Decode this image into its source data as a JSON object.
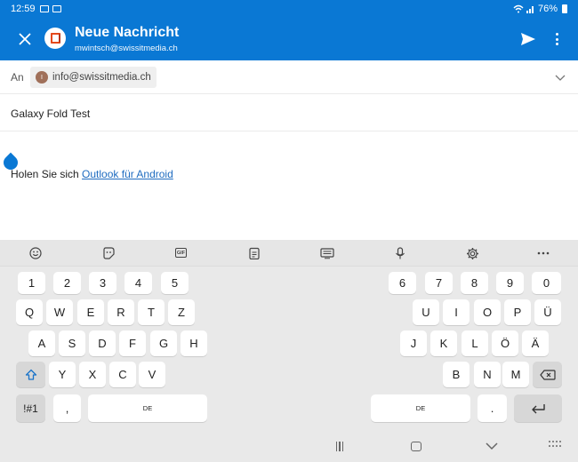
{
  "status_bar": {
    "time": "12:59",
    "battery": "76%"
  },
  "header": {
    "title": "Neue Nachricht",
    "account": "mwintsch@swissitmedia.ch"
  },
  "compose": {
    "to_label": "An",
    "recipient_initial": "I",
    "recipient": "info@swissitmedia.ch",
    "subject": "Galaxy Fold Test",
    "body_prefix": "Holen Sie sich ",
    "body_link": "Outlook für Android"
  },
  "keyboard": {
    "toolbar": [
      "emoji",
      "sticker",
      "GIF",
      "clipboard",
      "keyboard-mode",
      "voice-input",
      "settings",
      "more"
    ],
    "gif_label": "GIF",
    "left": {
      "row1": [
        "1",
        "2",
        "3",
        "4",
        "5"
      ],
      "row2": [
        "Q",
        "W",
        "E",
        "R",
        "T",
        "Z"
      ],
      "row3": [
        "A",
        "S",
        "D",
        "F",
        "G",
        "H"
      ],
      "row4": [
        "Y",
        "X",
        "C",
        "V"
      ],
      "symbols": "!#1",
      "comma": ",",
      "space_label": "DE"
    },
    "right": {
      "row1": [
        "6",
        "7",
        "8",
        "9",
        "0"
      ],
      "row2": [
        "U",
        "I",
        "O",
        "P",
        "Ü"
      ],
      "row3": [
        "J",
        "K",
        "L",
        "Ö",
        "Ä"
      ],
      "row4": [
        "B",
        "N",
        "M"
      ],
      "space_label": "DE",
      "period": "."
    }
  },
  "colors": {
    "accent": "#0a78d4",
    "link": "#1f6cc0",
    "keyboard_bg": "#e9e9e9"
  }
}
